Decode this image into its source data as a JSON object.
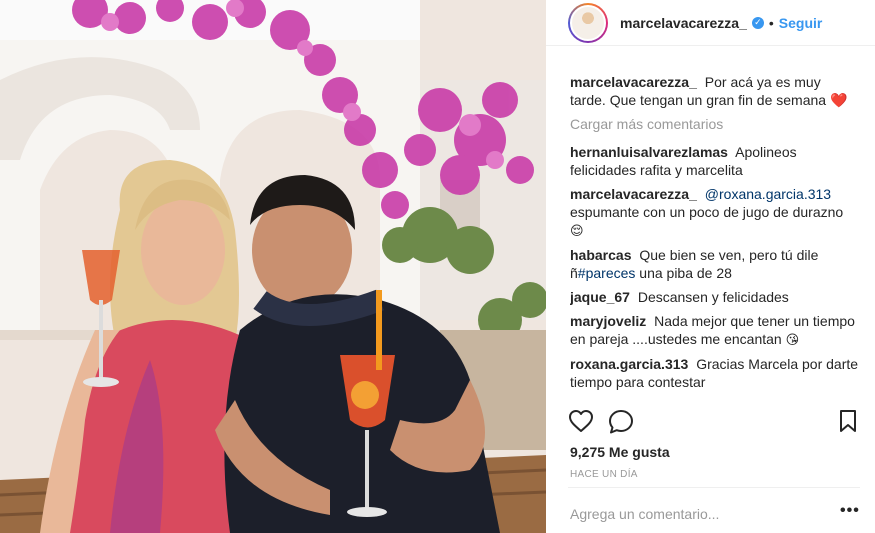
{
  "post": {
    "username": "marcelavacarezza_",
    "separator": "•",
    "follow_label": "Seguir"
  },
  "icons": {
    "verified": "verified-badge-icon",
    "like": "heart-outline-icon",
    "comment": "speech-bubble-icon",
    "save": "bookmark-icon",
    "more": "ellipsis-icon"
  },
  "comments": {
    "caption": {
      "user": "marcelavacarezza_",
      "text": "Por acá ya es muy tarde. Que tengan un gran fin de semana",
      "emoji": "❤️"
    },
    "load_more": "Cargar más comentarios",
    "items": [
      {
        "user": "hernanluisalvarezlamas",
        "text": "Apolineos felicidades rafita y marcelita"
      },
      {
        "user": "marcelavacarezza_",
        "mention": "@roxana.garcia.313",
        "text": "espumante con un poco de jugo de durazno",
        "emoji": "😌"
      },
      {
        "user": "habarcas",
        "text": "Que bien se ven, pero tú dile ñ",
        "hashtag": "#pareces",
        "text_after": "una piba de 28"
      },
      {
        "user": "jaque_67",
        "text": "Descansen y felicidades"
      },
      {
        "user": "maryjoveliz",
        "text": "Nada mejor que tener un tiempo en pareja ....ustedes me encantan",
        "emoji": "😘"
      },
      {
        "user": "roxana.garcia.313",
        "text": "Gracias Marcela por darte tiempo para contestar"
      }
    ]
  },
  "stats": {
    "likes": "9,275 Me gusta",
    "date": "HACE UN DÍA"
  },
  "input": {
    "placeholder": "Agrega un comentario...",
    "more": "•••"
  },
  "colors": {
    "accent": "#3897f0",
    "text": "#262626",
    "muted": "#999999",
    "mention": "#003569"
  }
}
